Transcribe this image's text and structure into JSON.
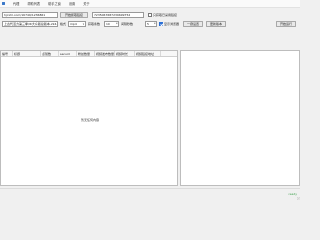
{
  "menu": {
    "items": [
      "代理",
      "帮助列表",
      "助手之窗",
      "设置",
      "关于"
    ]
  },
  "toolbar": {
    "url_value": "hjcxhl.com/16749/1236861",
    "start_button": "开始抓取链接",
    "code_value": "7235067687239699752",
    "disable_sniff_label": "只获取已采用链接",
    "path_value": "上古代活力第三季/IK大众版总版本,2k4+.txt",
    "format_label": "格式",
    "format_value": "mp4",
    "count_label": "获取条数",
    "count_value": "10",
    "interval_label": "间隔秒数",
    "interval_value": "5",
    "show_browser_label": "显示浏览器",
    "download_button": "一键设置",
    "update_button": "更新版本",
    "start_crawl_button": "开始运行"
  },
  "table": {
    "columns": [
      "编号",
      "标题",
      "点赞数",
      "secuid",
      "粉丝数量",
      "视频发布数量",
      "视频时长",
      "视频链接地址"
    ],
    "empty_text": "暂无任何内容"
  },
  "status": {
    "right_text": "ready"
  },
  "colors": {
    "checkbox_checked": "#2a6fd6",
    "status_text": "#3aa04a"
  }
}
